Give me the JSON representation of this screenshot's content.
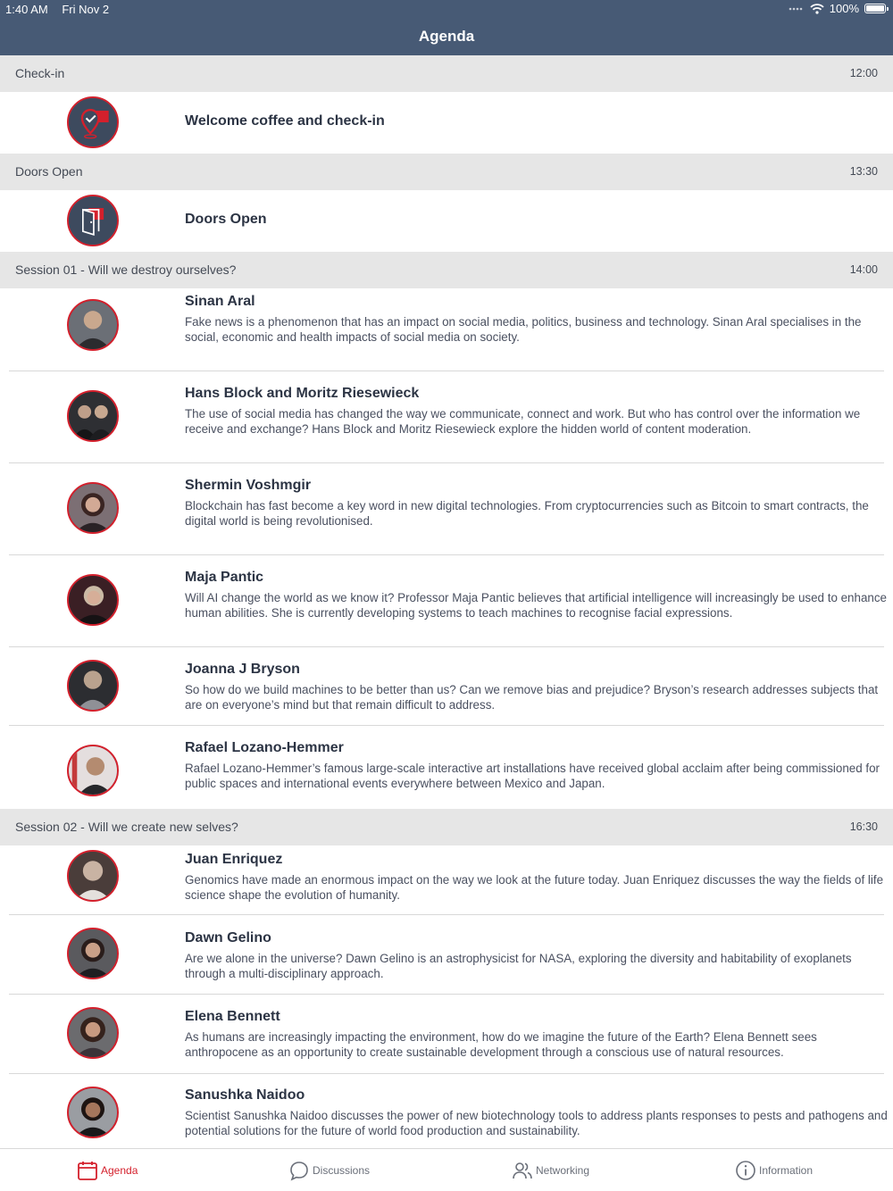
{
  "status": {
    "time": "1:40 AM",
    "date": "Fri Nov 2",
    "battery": "100%",
    "signal_icon": "wifi-icon"
  },
  "nav": {
    "title": "Agenda"
  },
  "colors": {
    "navbar": "#475a75",
    "accent": "#d4202c",
    "section_bg": "#e6e6e6"
  },
  "sections": [
    {
      "title": "Check-in",
      "time": "12:00"
    },
    {
      "title": "Doors Open",
      "time": "13:30"
    },
    {
      "title": "Session 01 - Will we destroy ourselves?",
      "time": "14:00"
    },
    {
      "title": "Session 02 - Will we create new selves?",
      "time": "16:30"
    }
  ],
  "items": [
    {
      "title": "Welcome coffee and check-in",
      "desc": "",
      "icon": "checkin-pin-icon"
    },
    {
      "title": "Doors Open",
      "desc": "",
      "icon": "door-icon"
    },
    {
      "title": "Sinan Aral",
      "desc": "Fake news is a phenomenon that has an impact on social media, politics, business and technology. Sinan Aral specialises in the social, economic and health impacts of social media on society.",
      "icon": "speaker-photo"
    },
    {
      "title": "Hans Block and Moritz Riesewieck",
      "desc": "The use of social media has changed the way we communicate, connect and work. But who has control over the information we receive and exchange? Hans Block and Moritz Riesewieck explore the hidden world of content moderation.",
      "icon": "speaker-photo"
    },
    {
      "title": "Shermin Voshmgir",
      "desc": "Blockchain has fast become a key word in new digital technologies. From cryptocurrencies such as Bitcoin to smart contracts, the digital world is being revolutionised.",
      "icon": "speaker-photo"
    },
    {
      "title": "Maja Pantic",
      "desc": "Will AI change the world as we know it? Professor Maja Pantic believes that artificial  intelligence will increasingly be used to enhance human abilities. She is currently developing systems to teach machines to recognise facial expressions.",
      "icon": "speaker-photo"
    },
    {
      "title": "Joanna J Bryson",
      "desc": "So how do we build machines to be better than us? Can we remove bias and prejudice? Bryson’s research addresses subjects that are on everyone’s mind but that remain difficult to address.",
      "icon": "speaker-photo"
    },
    {
      "title": "Rafael Lozano-Hemmer",
      "desc": "Rafael Lozano-Hemmer’s famous large-scale interactive art installations have received global acclaim after being commissioned for public spaces and international events everywhere between Mexico and Japan.",
      "icon": "speaker-photo"
    },
    {
      "title": "Juan Enriquez",
      "desc": "Genomics have made an enormous impact on the way we look at the future today. Juan Enriquez discusses the way the fields of life science shape the evolution of humanity.",
      "icon": "speaker-photo"
    },
    {
      "title": "Dawn Gelino",
      "desc": "Are we alone in the universe? Dawn Gelino is an astrophysicist for NASA, exploring the diversity and habitability of exoplanets through a multi-disciplinary approach.",
      "icon": "speaker-photo"
    },
    {
      "title": "Elena Bennett",
      "desc": "As humans are increasingly impacting the environment, how do we imagine the future of the Earth? Elena Bennett sees anthropocene as an opportunity to create sustainable development through a conscious use of natural resources.",
      "icon": "speaker-photo"
    },
    {
      "title": "Sanushka Naidoo",
      "desc": "Scientist Sanushka Naidoo discusses the power of new biotechnology tools to address plants responses to pests and pathogens and potential solutions for the future of world food production and sustainability.",
      "icon": "speaker-photo"
    }
  ],
  "tabs": [
    {
      "label": "Agenda",
      "icon": "calendar-icon",
      "active": true
    },
    {
      "label": "Discussions",
      "icon": "chat-bubble-icon",
      "active": false
    },
    {
      "label": "Networking",
      "icon": "people-icon",
      "active": false
    },
    {
      "label": "Information",
      "icon": "info-icon",
      "active": false
    }
  ]
}
